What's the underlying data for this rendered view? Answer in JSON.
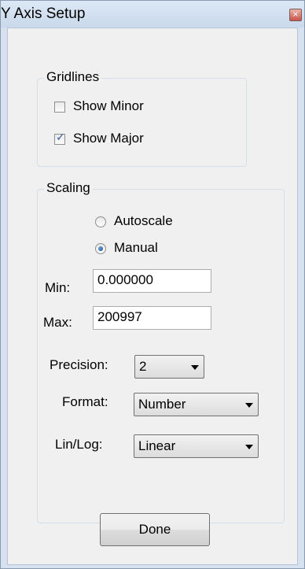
{
  "window": {
    "title": "Y Axis Setup",
    "close_glyph": "×"
  },
  "gridlines": {
    "legend": "Gridlines",
    "show_minor": {
      "label": "Show Minor",
      "checked": false
    },
    "show_major": {
      "label": "Show Major",
      "checked": true
    }
  },
  "scaling": {
    "legend": "Scaling",
    "autoscale": {
      "label": "Autoscale",
      "selected": false
    },
    "manual": {
      "label": "Manual",
      "selected": true
    },
    "min": {
      "label": "Min:",
      "value": "0.000000"
    },
    "max": {
      "label": "Max:",
      "value": "200997"
    },
    "precision": {
      "label": "Precision:",
      "value": "2"
    },
    "format": {
      "label": "Format:",
      "value": "Number"
    },
    "linlog": {
      "label": "Lin/Log:",
      "value": "Linear"
    }
  },
  "actions": {
    "done_label": "Done"
  }
}
